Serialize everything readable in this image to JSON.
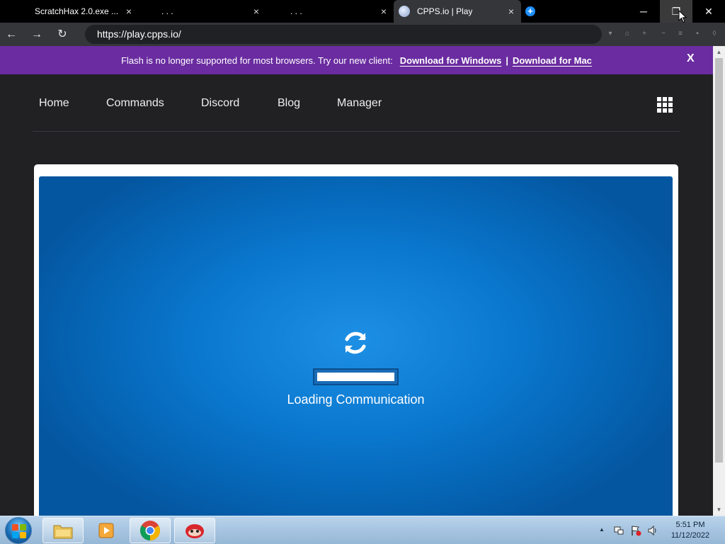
{
  "tabs": [
    {
      "label": "ScratchHax 2.0.exe ...",
      "active": false
    },
    {
      "label": ". . .",
      "active": false
    },
    {
      "label": ". . .",
      "active": false
    },
    {
      "label": "CPPS.io | Play",
      "active": true
    }
  ],
  "tab_close_glyph": "×",
  "window_controls": {
    "minimize": "─",
    "restore": "❐",
    "close": "✕"
  },
  "toolbar": {
    "back": "←",
    "forward": "→",
    "reload": "↻",
    "url": "https://play.cpps.io/"
  },
  "banner": {
    "message": "Flash is no longer supported for most browsers. Try our new client:",
    "download_windows": "Download for Windows",
    "separator": "|",
    "download_mac": "Download for Mac",
    "close": "X",
    "color": "#6a2ca0"
  },
  "site_nav": {
    "items": [
      "Home",
      "Commands",
      "Discord",
      "Blog",
      "Manager"
    ],
    "menu_icon": "grid-icon"
  },
  "game": {
    "status_text": "Loading Communication",
    "progress": 1.0,
    "background_color": "#0a78cf"
  },
  "taskbar": {
    "pinned": [
      "file-explorer-icon",
      "media-player-icon",
      "chrome-icon",
      "game-client-icon"
    ],
    "tray_expand": "▲",
    "time": "5:51 PM",
    "date": "11/12/2022"
  }
}
